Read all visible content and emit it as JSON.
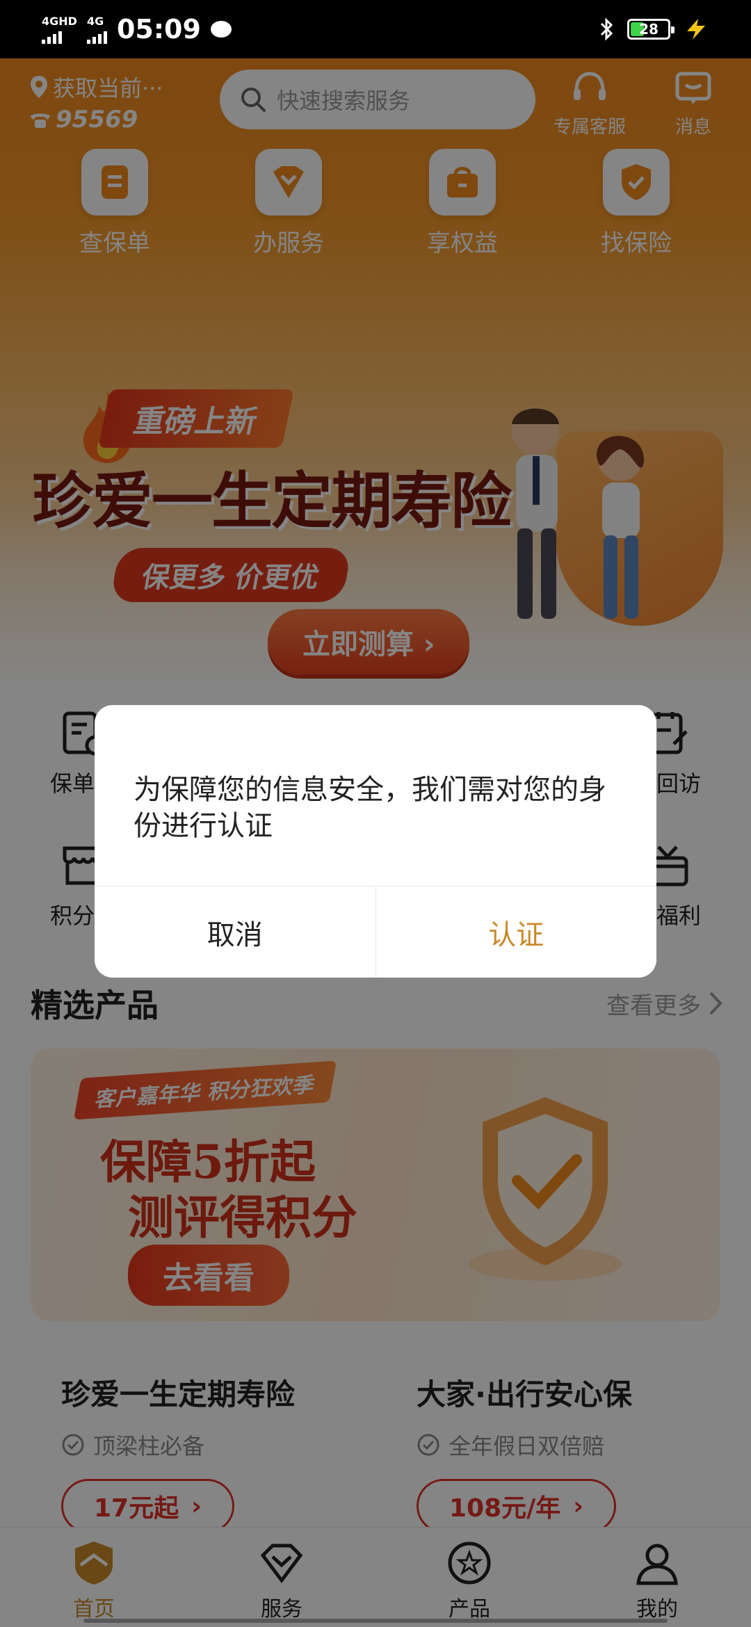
{
  "status_bar": {
    "network_1": "4GHD",
    "network_2": "4G",
    "time": "05:09",
    "battery": "28"
  },
  "header": {
    "location": "获取当前···",
    "hotline": "95569",
    "search_placeholder": "快速搜索服务",
    "support_label": "专属客服",
    "messages_label": "消息"
  },
  "quick_actions": [
    {
      "label": "查保单",
      "icon": "policy-icon"
    },
    {
      "label": "办服务",
      "icon": "service-icon"
    },
    {
      "label": "享权益",
      "icon": "benefit-bag-icon"
    },
    {
      "label": "找保险",
      "icon": "shield-check-icon"
    }
  ],
  "banner": {
    "tag": "重磅上新",
    "title": "珍爱一生定期寿险",
    "subtitle": "保更多 价更优",
    "cta": "立即测算 ›"
  },
  "services": {
    "row1_left": "保单变",
    "row1_right": "单回访",
    "row2_left": "积分商",
    "row2_right": "人福利"
  },
  "products": {
    "section_title": "精选产品",
    "more_label": "查看更多",
    "promo": {
      "tag": "客户嘉年华 积分狂欢季",
      "line1": "保障5折起",
      "line2": "测评得积分",
      "cta": "去看看"
    },
    "cards": [
      {
        "title": "珍爱一生定期寿险",
        "feature": "顶梁柱必备",
        "price": "17元起"
      },
      {
        "title": "大家·出行安心保",
        "feature": "全年假日双倍赔",
        "price": "108元/年"
      }
    ]
  },
  "tabbar": [
    {
      "label": "首页",
      "active": true
    },
    {
      "label": "服务",
      "active": false
    },
    {
      "label": "产品",
      "active": false
    },
    {
      "label": "我的",
      "active": false
    }
  ],
  "dialog": {
    "message": "为保障您的信息安全，我们需对您的身份进行认证",
    "cancel": "取消",
    "confirm": "认证"
  },
  "colors": {
    "brand_orange": "#f28a1e",
    "accent_gold": "#c98a2a",
    "price_red": "#e0312a"
  }
}
